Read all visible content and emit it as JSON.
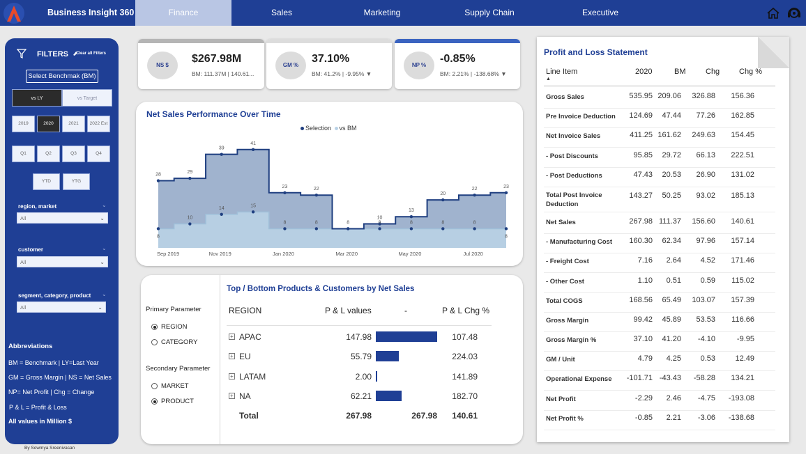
{
  "app": {
    "title": "Business Insight 360"
  },
  "nav": {
    "tabs": [
      "Finance",
      "Sales",
      "Marketing",
      "Supply Chain",
      "Executive"
    ]
  },
  "sidebar": {
    "filters_label": "FILTERS",
    "clear_label": "Clear all Filters",
    "benchmark_button": "Select Benchmak (BM)",
    "compare": [
      "vs LY",
      "vs Target"
    ],
    "years": [
      "2019",
      "2020",
      "2021",
      "2022 Est"
    ],
    "quarters": [
      "Q1",
      "Q2",
      "Q3",
      "Q4"
    ],
    "periods": [
      "YTD",
      "YTG"
    ],
    "slicers": [
      {
        "label": "region, market",
        "value": "All"
      },
      {
        "label": "customer",
        "value": "All"
      },
      {
        "label": "segment, category, product",
        "value": "All"
      }
    ],
    "abbreviations_title": "Abbreviations",
    "abbreviations": [
      "BM = Benchmark | LY=Last Year",
      "GM = Gross Margin | NS = Net Sales",
      "NP= Net Profit | Chg = Change",
      "P & L = Profit & Loss"
    ],
    "note": "All values in Million $",
    "credit": "By Sowmya Sreenivasan"
  },
  "kpis": [
    {
      "icon": "NS $",
      "value": "$267.98M",
      "sub": "BM: 111.37M | 140.61...",
      "color": "#b5b5b5"
    },
    {
      "icon": "GM %",
      "value": "37.10%",
      "sub": "BM: 41.2% | -9.95% ▼",
      "color": "#dcdcdc"
    },
    {
      "icon": "NP %",
      "value": "-0.85%",
      "sub": "BM: 2.21% | -138.68% ▼",
      "color": "#3a63c0"
    }
  ],
  "chart": {
    "title": "Net Sales Performance Over Time",
    "legend": [
      "Selection",
      "vs BM"
    ],
    "colors": {
      "selection": "#1f3f80",
      "bm": "#b9d2e6",
      "selection_fill": "#8fa6c6"
    }
  },
  "chart_data": {
    "type": "area",
    "x": [
      "Sep 2019",
      "Oct 2019",
      "Nov 2019",
      "Dec 2019",
      "Jan 2020",
      "Feb 2020",
      "Mar 2020",
      "Apr 2020",
      "May 2020",
      "Jun 2020",
      "Jul 2020",
      "Aug 2020"
    ],
    "tick_labels": [
      "Sep 2019",
      "Nov 2019",
      "Jan 2020",
      "Mar 2020",
      "May 2020",
      "Jul 2020"
    ],
    "series": [
      {
        "name": "Selection",
        "values": [
          28,
          29,
          39,
          41,
          23,
          22,
          8,
          10,
          13,
          20,
          22,
          23
        ],
        "labels": [
          "28",
          "29",
          "39",
          "41",
          "23",
          "22",
          "8",
          "10",
          "13",
          "20",
          "22",
          "23"
        ]
      },
      {
        "name": "vs BM",
        "values": [
          8,
          10,
          14,
          15,
          8,
          8,
          8,
          8,
          8,
          8,
          8,
          8
        ],
        "labels": [
          "8",
          "10",
          "14",
          "15",
          "8",
          "8",
          "",
          "8",
          "8",
          "8",
          "8",
          "8"
        ]
      }
    ],
    "ylim": [
      0,
      45
    ]
  },
  "params": {
    "primary_title": "Primary Parameter",
    "primary_options": [
      "REGION",
      "CATEGORY"
    ],
    "primary_selected": 0,
    "secondary_title": "Secondary Parameter",
    "secondary_options": [
      "MARKET",
      "PRODUCT"
    ],
    "secondary_selected": 1
  },
  "top_bottom": {
    "title": "Top / Bottom Products & Customers by Net Sales",
    "headers": [
      "REGION",
      "P & L values",
      "-",
      "P & L Chg %"
    ],
    "rows": [
      {
        "name": "APAC",
        "value": "147.98",
        "chg": "107.48",
        "bar": 147.98
      },
      {
        "name": "EU",
        "value": "55.79",
        "chg": "224.03",
        "bar": 55.79
      },
      {
        "name": "LATAM",
        "value": "2.00",
        "chg": "141.89",
        "bar": 2.0
      },
      {
        "name": "NA",
        "value": "62.21",
        "chg": "182.70",
        "bar": 62.21
      }
    ],
    "total": {
      "label": "Total",
      "value": "267.98",
      "bar_value": "267.98",
      "chg": "140.61"
    }
  },
  "pl": {
    "title": "Profit and Loss Statement",
    "headers": [
      "Line Item",
      "2020",
      "BM",
      "Chg",
      "Chg %"
    ],
    "rows": [
      {
        "item": "Gross Sales",
        "v2020": "535.95",
        "bm": "209.06",
        "chg": "326.88",
        "pct": "156.36"
      },
      {
        "item": "Pre Invoice Deduction",
        "v2020": "124.69",
        "bm": "47.44",
        "chg": "77.26",
        "pct": "162.85"
      },
      {
        "item": "Net Invoice Sales",
        "v2020": "411.25",
        "bm": "161.62",
        "chg": "249.63",
        "pct": "154.45"
      },
      {
        "item": "- Post Discounts",
        "v2020": "95.85",
        "bm": "29.72",
        "chg": "66.13",
        "pct": "222.51"
      },
      {
        "item": "- Post Deductions",
        "v2020": "47.43",
        "bm": "20.53",
        "chg": "26.90",
        "pct": "131.02"
      },
      {
        "item": "Total Post Invoice Deduction",
        "v2020": "143.27",
        "bm": "50.25",
        "chg": "93.02",
        "pct": "185.13"
      },
      {
        "item": "Net Sales",
        "v2020": "267.98",
        "bm": "111.37",
        "chg": "156.60",
        "pct": "140.61"
      },
      {
        "item": "- Manufacturing Cost",
        "v2020": "160.30",
        "bm": "62.34",
        "chg": "97.96",
        "pct": "157.14"
      },
      {
        "item": "- Freight Cost",
        "v2020": "7.16",
        "bm": "2.64",
        "chg": "4.52",
        "pct": "171.46"
      },
      {
        "item": "- Other Cost",
        "v2020": "1.10",
        "bm": "0.51",
        "chg": "0.59",
        "pct": "115.02"
      },
      {
        "item": "Total COGS",
        "v2020": "168.56",
        "bm": "65.49",
        "chg": "103.07",
        "pct": "157.39"
      },
      {
        "item": "Gross Margin",
        "v2020": "99.42",
        "bm": "45.89",
        "chg": "53.53",
        "pct": "116.66"
      },
      {
        "item": "Gross Margin %",
        "v2020": "37.10",
        "bm": "41.20",
        "chg": "-4.10",
        "pct": "-9.95"
      },
      {
        "item": "GM / Unit",
        "v2020": "4.79",
        "bm": "4.25",
        "chg": "0.53",
        "pct": "12.49"
      },
      {
        "item": "Operational Expense",
        "v2020": "-101.71",
        "bm": "-43.43",
        "chg": "-58.28",
        "pct": "134.21"
      },
      {
        "item": "Net Profit",
        "v2020": "-2.29",
        "bm": "2.46",
        "chg": "-4.75",
        "pct": "-193.08"
      },
      {
        "item": "Net Profit %",
        "v2020": "-0.85",
        "bm": "2.21",
        "chg": "-3.06",
        "pct": "-138.68"
      }
    ]
  }
}
